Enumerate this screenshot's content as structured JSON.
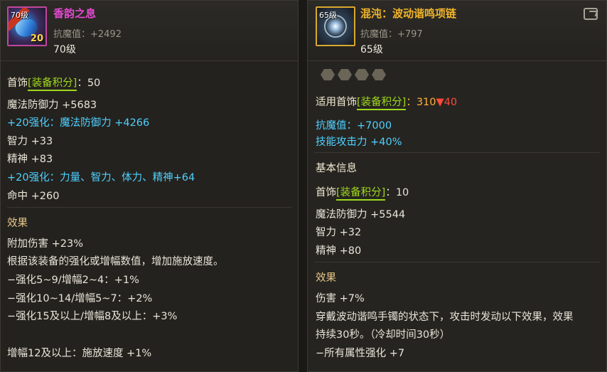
{
  "left": {
    "item_name": "香韵之息",
    "icon_level": "70级",
    "icon_plus": "20",
    "anti_magic": "抗魔值：+2492",
    "level": "70级",
    "score_prefix": "首饰",
    "score_tag": "[装备积分]",
    "score_value": "：50",
    "stats": [
      "魔法防御力 +5683",
      "+20强化：魔法防御力 +4266",
      "智力 +33",
      "精神 +83",
      "+20强化：力量、智力、体力、精神+64",
      "命中 +260"
    ],
    "effect_title": "效果",
    "effects": [
      "附加伤害 +23%",
      "根据该装备的强化或增幅数值，增加施放速度。",
      "−强化5~9/增幅2~4：+1%",
      "−强化10~14/增幅5~7：+2%",
      "−强化15及以上/增幅8及以上：+3%",
      "增幅12及以上：施放速度 +1%"
    ]
  },
  "right": {
    "item_name": "混沌：波动谐鸣项链",
    "icon_level": "65级",
    "anti_magic": "抗魔值：+797",
    "level": "65级",
    "score_prefix": "适用首饰",
    "score_tag": "[装备积分]",
    "score_value": "：310",
    "score_delta": "▼40",
    "bonus_stats": [
      "抗魔值：+7000",
      "技能攻击力 +40%"
    ],
    "basic_title": "基本信息",
    "basic_score_prefix": "首饰",
    "basic_score_tag": "[装备积分]",
    "basic_score_value": "：10",
    "basic_stats": [
      "魔法防御力 +5544",
      "智力 +32",
      "精神 +80"
    ],
    "effect_title": "效果",
    "effects": [
      "伤害 +7%",
      "穿戴波动谐鸣手镯的状态下，攻击时发动以下效果，效果",
      "持续30秒。（冷却时间30秒）",
      "−所有属性强化 +7"
    ]
  },
  "colors": {
    "epic_name": "#e34ad0",
    "legendary_name": "#f0b429",
    "enhance_blue": "#4fd0ff",
    "score_green": "#9fd81e",
    "decrease_red": "#ff4a3a"
  },
  "icons": [
    "gem-necklace-icon",
    "chaos-orb-necklace-icon",
    "share-icon",
    "socket-icon"
  ]
}
